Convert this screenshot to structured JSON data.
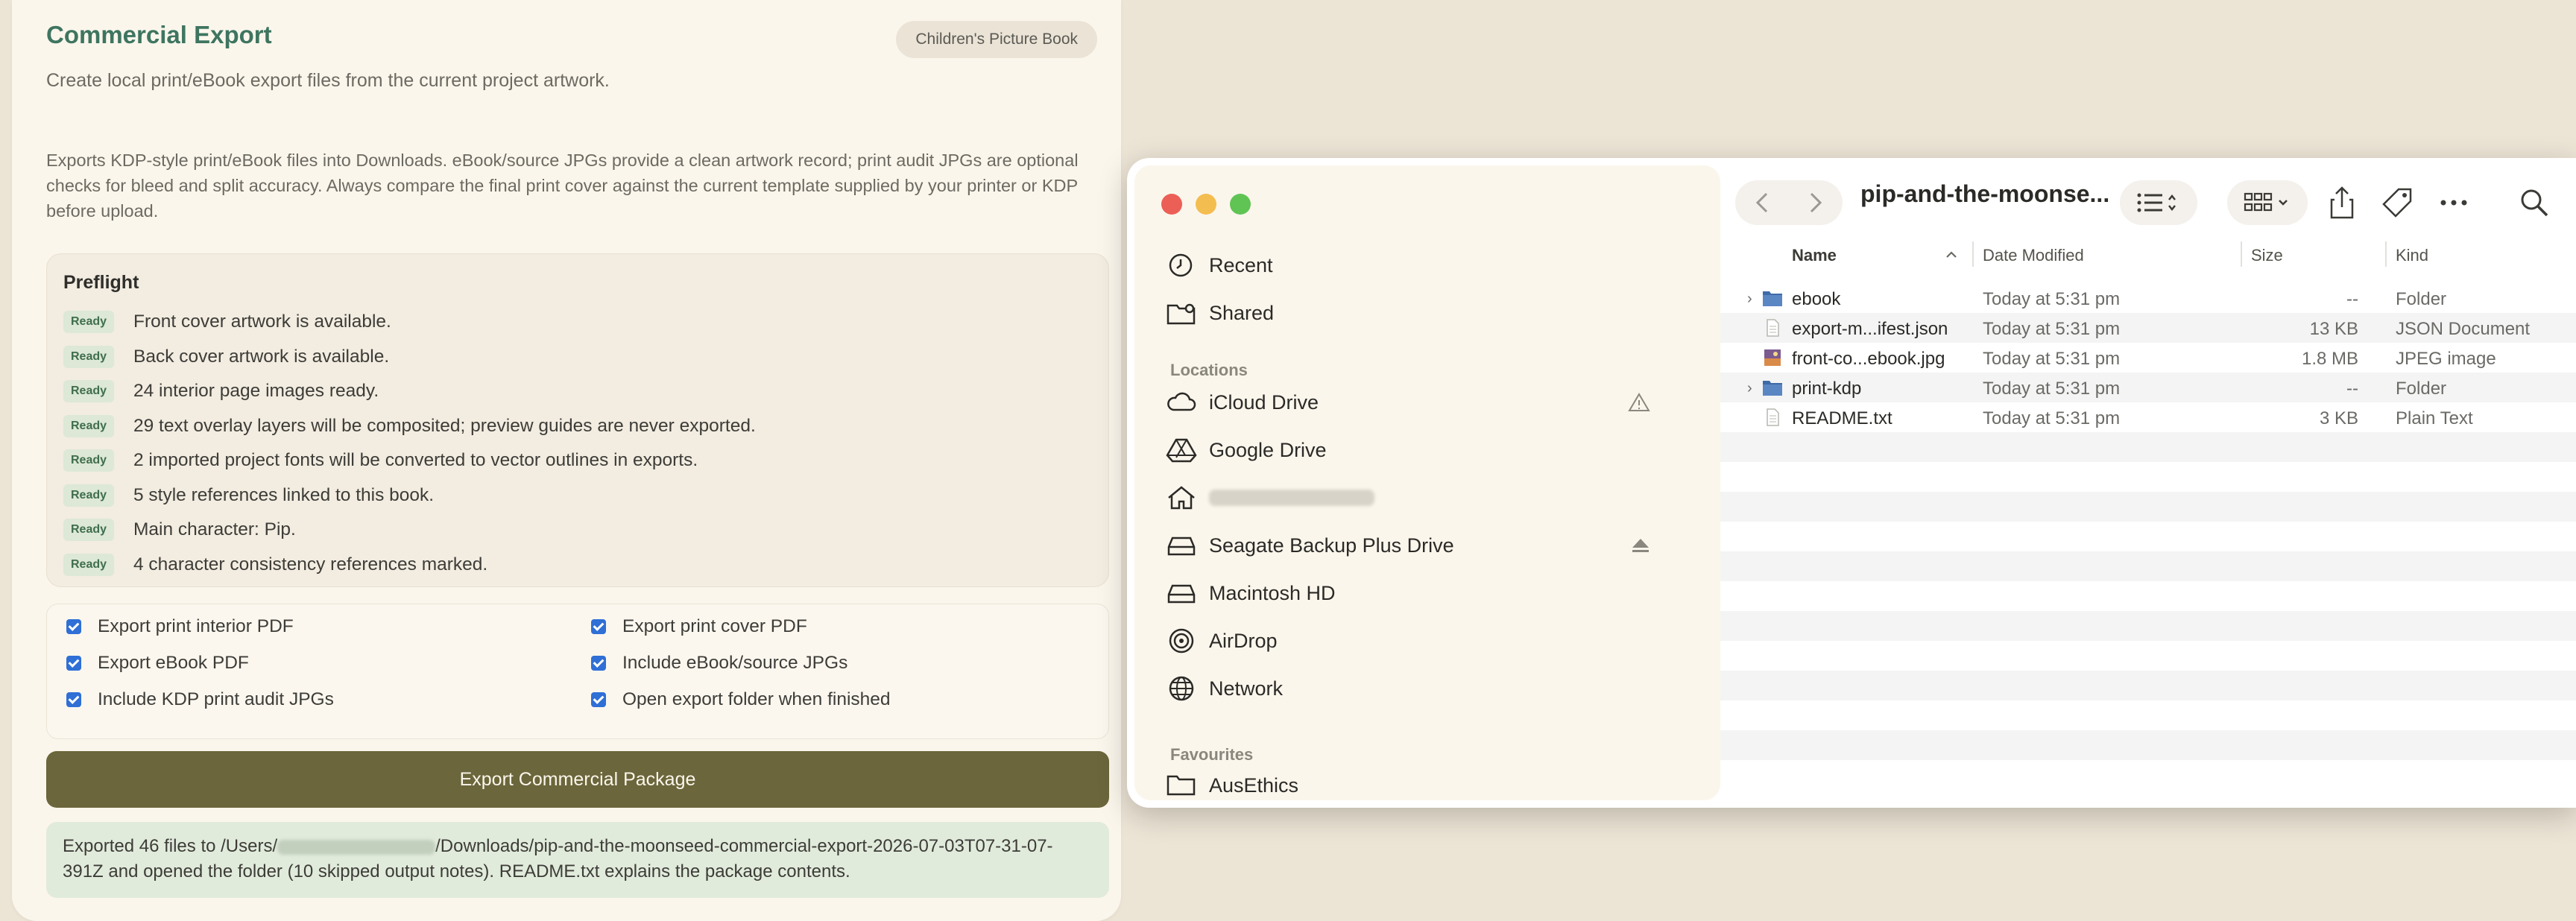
{
  "app": {
    "title": "Commercial Export",
    "badge": "Children's Picture Book",
    "subtitle": "Create local print/eBook export files from the current project artwork.",
    "description": "Exports KDP-style print/eBook files into Downloads. eBook/source JPGs provide a clean artwork record; print audit JPGs are optional checks for bleed and split accuracy. Always compare the final print cover against the current template supplied by your printer or KDP before upload."
  },
  "preflight": {
    "title": "Preflight",
    "badge_label": "Ready",
    "items": [
      "Front cover artwork is available.",
      "Back cover artwork is available.",
      "24 interior page images ready.",
      "29 text overlay layers will be composited; preview guides are never exported.",
      "2 imported project fonts will be converted to vector outlines in exports.",
      "5 style references linked to this book.",
      "Main character: Pip.",
      "4 character consistency references marked."
    ]
  },
  "options": [
    {
      "label": "Export print interior PDF",
      "checked": true
    },
    {
      "label": "Export print cover PDF",
      "checked": true
    },
    {
      "label": "Export eBook PDF",
      "checked": true
    },
    {
      "label": "Include eBook/source JPGs",
      "checked": true
    },
    {
      "label": "Include KDP print audit JPGs",
      "checked": true
    },
    {
      "label": "Open export folder when finished",
      "checked": true
    }
  ],
  "export_button": "Export Commercial Package",
  "result": {
    "prefix": "Exported 46 files to /Users/",
    "suffix": "/Downloads/pip-and-the-moonseed-commercial-export-2026-07-03T07-31-07-391Z and opened the folder (10 skipped output notes). README.txt explains the package contents."
  },
  "finder": {
    "folder_title": "pip-and-the-moonse...",
    "sidebar": {
      "top_items": [
        "Recent",
        "Shared"
      ],
      "locations_header": "Locations",
      "locations": [
        "iCloud Drive",
        "Google Drive",
        "",
        "Seagate Backup Plus Drive",
        "Macintosh HD",
        "AirDrop",
        "Network"
      ],
      "favourites_header": "Favourites",
      "favourites": [
        "AusEthics"
      ]
    },
    "columns": {
      "name": "Name",
      "date": "Date Modified",
      "size": "Size",
      "kind": "Kind"
    },
    "files": [
      {
        "name": "ebook",
        "date": "Today at 5:31 pm",
        "size": "--",
        "kind": "Folder",
        "type": "folder"
      },
      {
        "name": "export-m...ifest.json",
        "date": "Today at 5:31 pm",
        "size": "13 KB",
        "kind": "JSON Document",
        "type": "doc"
      },
      {
        "name": "front-co...ebook.jpg",
        "date": "Today at 5:31 pm",
        "size": "1.8 MB",
        "kind": "JPEG image",
        "type": "image"
      },
      {
        "name": "print-kdp",
        "date": "Today at 5:31 pm",
        "size": "--",
        "kind": "Folder",
        "type": "folder"
      },
      {
        "name": "README.txt",
        "date": "Today at 5:31 pm",
        "size": "3 KB",
        "kind": "Plain Text",
        "type": "doc"
      }
    ]
  },
  "colors": {
    "accent_green": "#3e7560",
    "button_olive": "#6b663b",
    "ready_bg": "#dde8d6",
    "checkbox_blue": "#2f6fd6"
  }
}
